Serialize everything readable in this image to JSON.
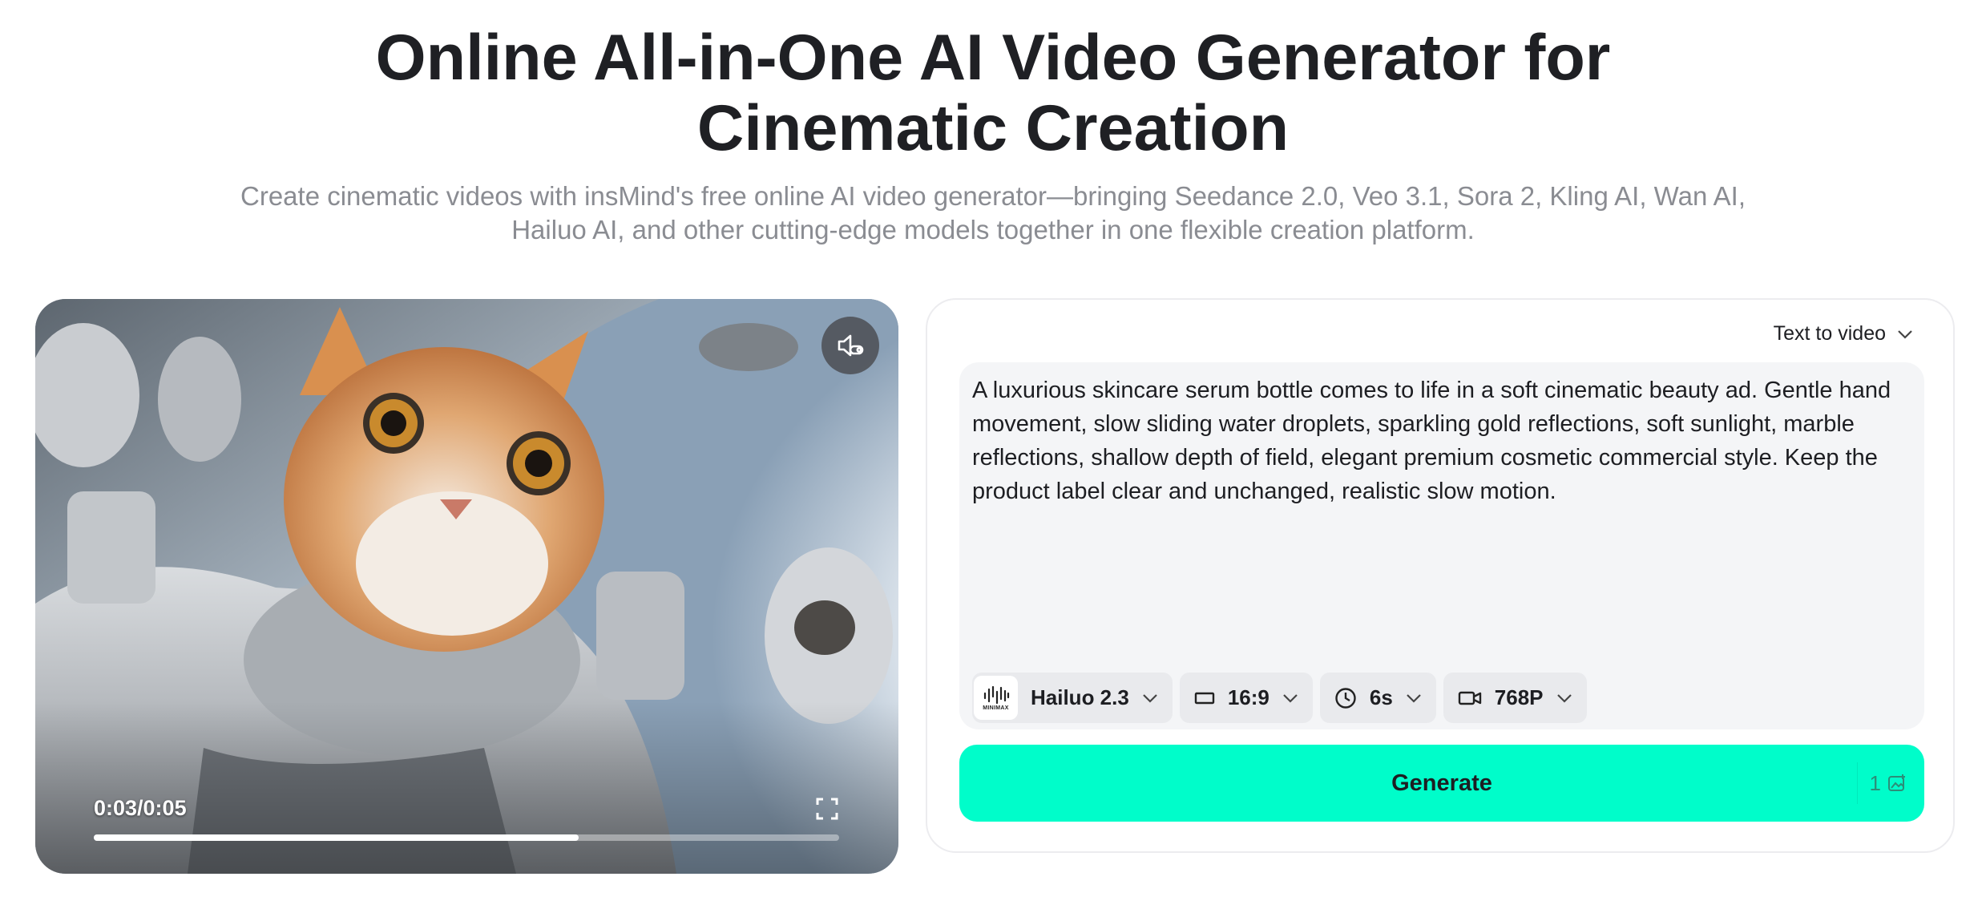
{
  "hero": {
    "title_line1": "Online All-in-One AI Video Generator for",
    "title_line2": "Cinematic Creation",
    "subtitle_line1": "Create cinematic videos with insMind's free online AI video generator—bringing Seedance 2.0, Veo 3.1, Sora 2, Kling AI, Wan AI,",
    "subtitle_line2": "Hailuo AI, and other cutting-edge models together in one flexible creation platform."
  },
  "player": {
    "time": "0:03/0:05",
    "progress_fraction": 0.65,
    "mute_icon": "speaker-muted-icon",
    "fullscreen_icon": "fullscreen-icon"
  },
  "generator": {
    "mode": "Text to video",
    "prompt": "A luxurious skincare serum bottle comes to life in a soft cinematic beauty ad. Gentle hand movement, slow sliding water droplets, sparkling gold reflections, soft sunlight, marble reflections, shallow depth of field, elegant premium cosmetic commercial style. Keep the product label clear and unchanged, realistic slow motion.",
    "model": {
      "logo_text": "MINIMAX",
      "label": "Hailuo 2.3"
    },
    "aspect_ratio": "16:9",
    "duration": "6s",
    "resolution": "768P",
    "generate_label": "Generate",
    "credits": "1"
  },
  "colors": {
    "accent": "#00fdca",
    "panel_border": "#ececef",
    "prompt_bg": "#f4f5f7",
    "chip_bg": "#e9eaed",
    "subtitle": "#8a8c92"
  }
}
